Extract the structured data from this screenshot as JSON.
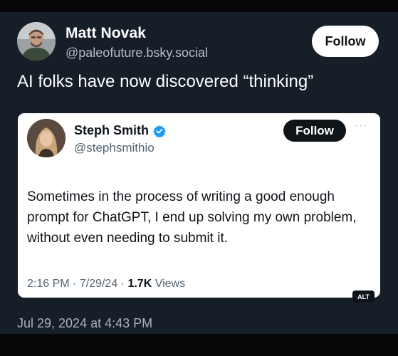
{
  "post": {
    "author_name": "Matt Novak",
    "author_handle": "@paleofuture.bsky.social",
    "follow_label": "Follow",
    "text": "AI folks have now discovered “thinking”",
    "timestamp": "Jul 29, 2024 at 4:43 PM"
  },
  "quote": {
    "author_name": "Steph Smith",
    "author_handle": "@stephsmithio",
    "follow_label": "Follow",
    "more_label": "···",
    "text": "Sometimes in the process of writing a good enough prompt for ChatGPT, I end up solving my own problem, without even needing to submit it.",
    "time": "2:16 PM",
    "date": "7/29/24",
    "separator": "·",
    "views_count": "1.7K",
    "views_label": "Views",
    "alt_label": "ALT"
  },
  "icons": {
    "verified": "verified-badge-icon",
    "avatar": "avatar",
    "more": "more-options-icon"
  },
  "colors": {
    "post_bg": "#161e27",
    "quote_bg": "#ffffff",
    "verified_blue": "#1d9bf0",
    "muted_text": "#536471"
  }
}
